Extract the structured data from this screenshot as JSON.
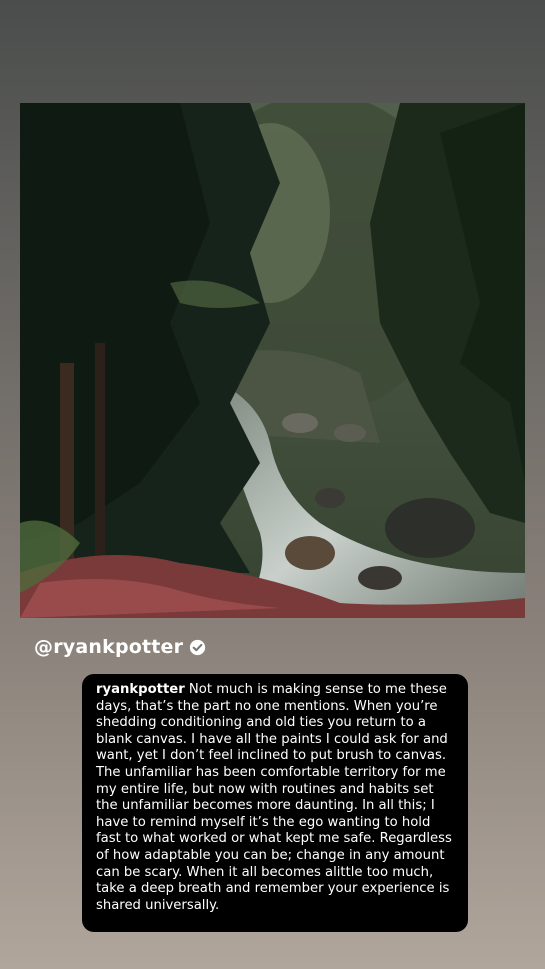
{
  "story": {
    "image": {
      "description_icon": "forest-stream-photo"
    }
  },
  "author": {
    "handle": "@ryankpotter",
    "verified_icon": "verified-badge-icon"
  },
  "caption": {
    "username": "ryankpotter",
    "text": " Not much is making sense to me these days, that’s the part no one mentions. When you’re shedding conditioning and old ties you return to a blank canvas. I have all the paints I could ask for and want, yet I don’t feel inclined to put brush to canvas. The unfamiliar has been comfortable territory for me my entire life, but now with routines and habits set the unfamiliar becomes more daunting. In all this; I have to remind myself it’s the ego wanting to hold fast to what worked or what kept me safe. Regardless of how adaptable you can be; change in any amount can be scary. When it all becomes alittle too much, take a deep breath and remember your experience is shared universally."
  },
  "colors": {
    "background_top": "#4a4d4c",
    "background_bottom": "#b0a69c",
    "caption_bg": "#000000",
    "text": "#ffffff"
  }
}
